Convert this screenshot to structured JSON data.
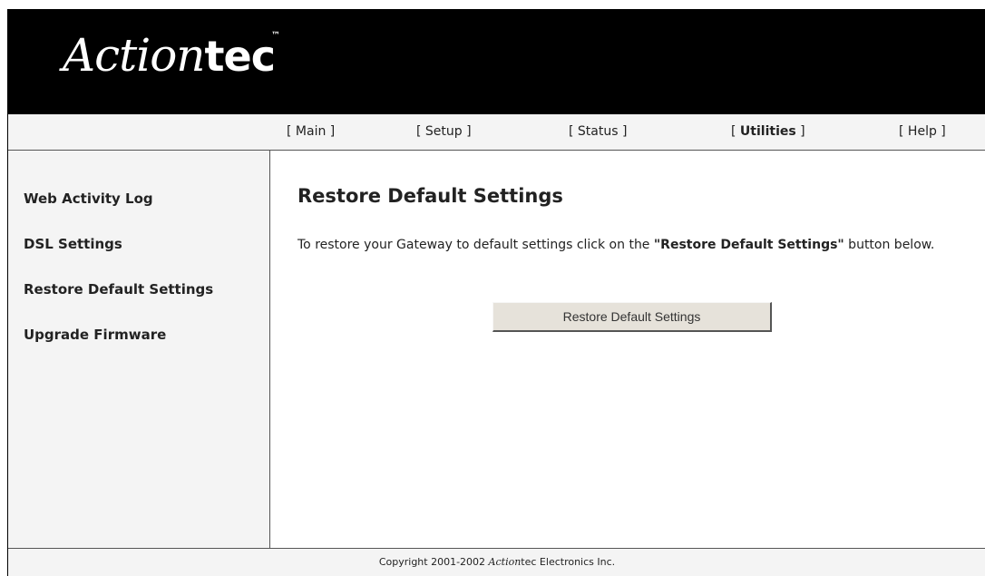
{
  "header": {
    "logo_script": "Action",
    "logo_bold": "tec",
    "logo_tm": "™"
  },
  "nav": {
    "items": [
      {
        "label": "Main"
      },
      {
        "label": "Setup"
      },
      {
        "label": "Status"
      },
      {
        "label": "Utilities",
        "active": true
      },
      {
        "label": "Help"
      }
    ]
  },
  "sidebar": {
    "items": [
      {
        "label": "Web Activity Log"
      },
      {
        "label": "DSL Settings"
      },
      {
        "label": "Restore Default Settings"
      },
      {
        "label": "Upgrade Firmware"
      }
    ]
  },
  "main": {
    "title": "Restore Default Settings",
    "instruction_prefix": "To restore your Gateway to default settings click on the ",
    "instruction_bold": "\"Restore Default Settings\"",
    "instruction_suffix": " button below.",
    "button_label": "Restore Default Settings"
  },
  "footer": {
    "prefix": "Copyright 2001-2002 ",
    "brand_italic": "Action",
    "brand_rest": "tec",
    "suffix": " Electronics Inc."
  }
}
